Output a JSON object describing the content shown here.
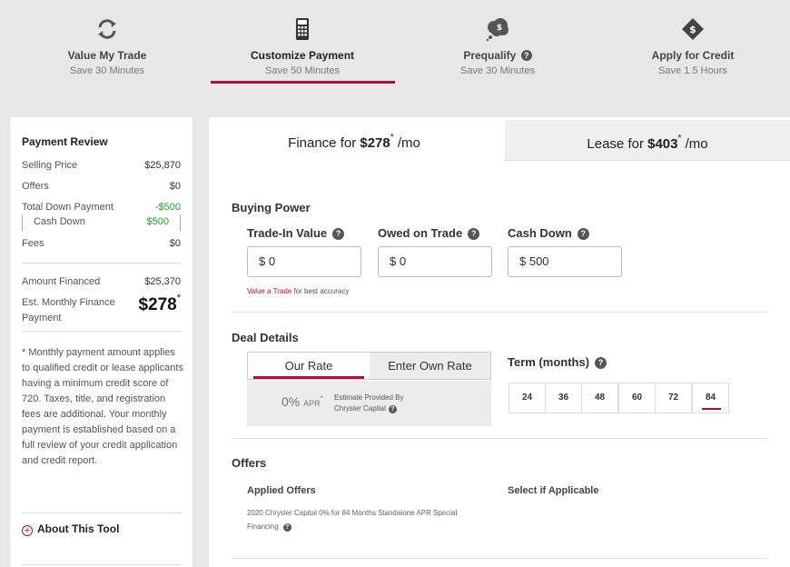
{
  "steps": [
    {
      "title": "Value My Trade",
      "sub": "Save 30 Minutes",
      "icon": "refresh-icon"
    },
    {
      "title": "Customize Payment",
      "sub": "Save 50 Minutes",
      "icon": "calculator-icon"
    },
    {
      "title": "Prequalify",
      "sub": "Save 30 Minutes",
      "icon": "money-cloud-icon"
    },
    {
      "title": "Apply for Credit",
      "sub": "Save 1.5 Hours",
      "icon": "tag-dollar-icon"
    }
  ],
  "review": {
    "title": "Payment Review",
    "selling_price_label": "Selling Price",
    "selling_price": "$25,870",
    "offers_label": "Offers",
    "offers": "$0",
    "total_down_label": "Total Down Payment",
    "total_down": "-$500",
    "cash_down_label": "Cash Down",
    "cash_down": "$500",
    "fees_label": "Fees",
    "fees": "$0",
    "amount_financed_label": "Amount Financed",
    "amount_financed": "$25,370",
    "est_monthly_label": "Est. Monthly Finance Payment",
    "est_monthly": "$278",
    "asterisk": "*",
    "disclaimer": "* Monthly payment amount applies to qualified credit or lease applicants having a minimum credit score of 720.  Taxes, title, and registration fees are additional. Your monthly payment is established based on a full review of your credit application and credit report.",
    "about": "About This Tool"
  },
  "tabs": {
    "finance_prefix": "Finance for ",
    "finance_amount": "$278",
    "finance_suffix": " /mo",
    "lease_prefix": "Lease for ",
    "lease_amount": "$403",
    "lease_suffix": " /mo",
    "asterisk": "*"
  },
  "buying_power": {
    "title": "Buying Power",
    "trade_in_label": "Trade-In Value",
    "trade_in_value": "$ 0",
    "owed_label": "Owed on Trade",
    "owed_value": "$ 0",
    "cash_down_label": "Cash Down",
    "cash_down_value": "$ 500",
    "value_trade_link": "Value a Trade",
    "value_trade_rest": " for best accuracy"
  },
  "deal": {
    "title": "Deal Details",
    "our_rate": "Our Rate",
    "own_rate": "Enter Own Rate",
    "apr_value": "0%",
    "apr_label": "APR",
    "apr_asterisk": "*",
    "provided_line1": "Estimate Provided By",
    "provided_line2": "Chrysler Capital",
    "term_label": "Term (months)",
    "terms": [
      "24",
      "36",
      "48",
      "60",
      "72",
      "84"
    ],
    "selected_term": "84"
  },
  "offers": {
    "title": "Offers",
    "applied_label": "Applied Offers",
    "select_label": "Select if Applicable",
    "offer_text": "2020 Chrysler Capital 0% for 84 Months Standalone APR Special Financing"
  },
  "colors": {
    "accent": "#a5133c",
    "green": "#2e9c2e"
  }
}
